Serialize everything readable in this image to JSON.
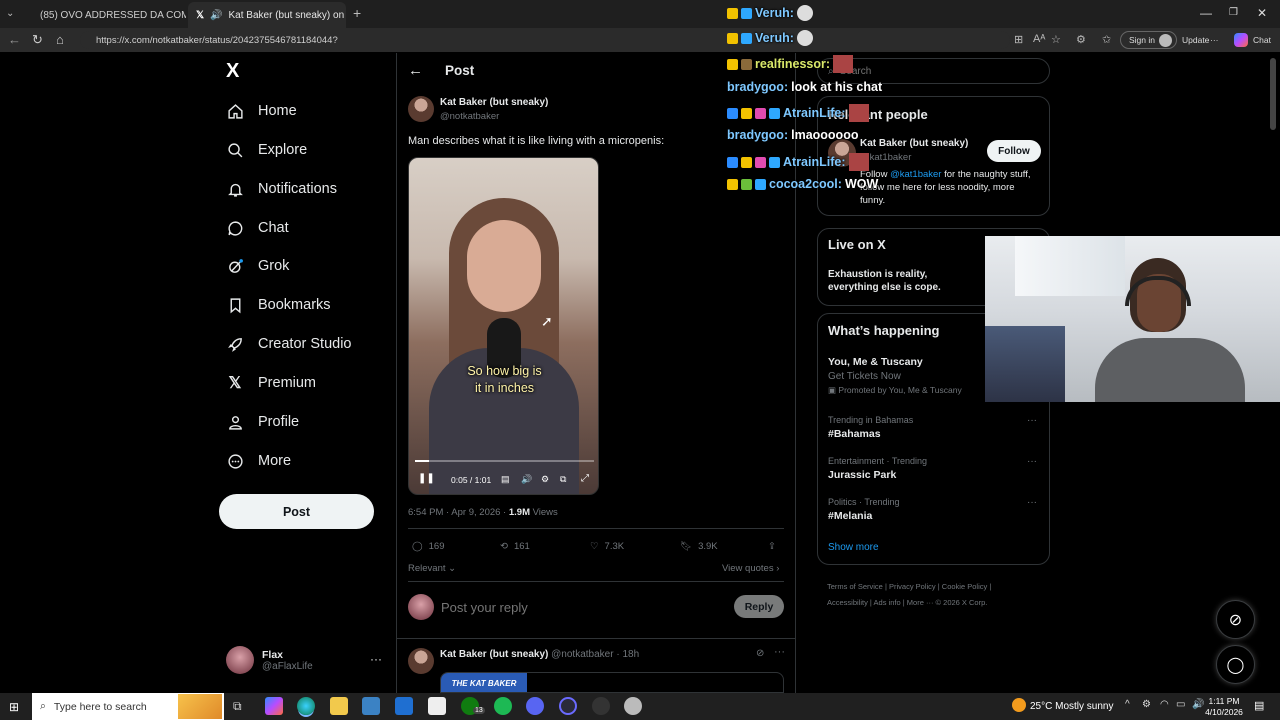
{
  "browser": {
    "tabs": [
      {
        "label": "(85) OVO ADDRESSED DA COMM..."
      },
      {
        "label": "Kat Baker (but sneaky) on X: \""
      }
    ],
    "url": "https://x.com/notkatbaker/status/2042375546781184044?",
    "signin_label": "Sign in",
    "update_label": "Update",
    "chat_label": "Chat"
  },
  "sidebar": {
    "logo": "X",
    "items": [
      {
        "label": "Home",
        "icon": "home-icon"
      },
      {
        "label": "Explore",
        "icon": "search-icon"
      },
      {
        "label": "Notifications",
        "icon": "bell-icon"
      },
      {
        "label": "Chat",
        "icon": "chat-icon"
      },
      {
        "label": "Grok",
        "icon": "grok-icon"
      },
      {
        "label": "Bookmarks",
        "icon": "bookmark-icon"
      },
      {
        "label": "Creator Studio",
        "icon": "rocket-icon"
      },
      {
        "label": "Premium",
        "icon": "x-premium-icon"
      },
      {
        "label": "Profile",
        "icon": "person-icon"
      },
      {
        "label": "More",
        "icon": "more-circle-icon"
      }
    ],
    "post_button": "Post",
    "account": {
      "name": "Flax",
      "handle": "@aFlaxLife"
    }
  },
  "post": {
    "header": "Post",
    "author": "Kat Baker (but sneaky)",
    "handle": "@notkatbaker",
    "text": "Man describes what it is like living with a micropenis:",
    "video_caption_1": "So how big is",
    "video_caption_2": "it in inches",
    "video_time": "0:05 / 1:01",
    "video_progress": 0.08,
    "timestamp": "6:54 PM · Apr 9, 2026 · ",
    "views_count": "1.9M",
    "views_label": " Views",
    "metrics": {
      "replies": "169",
      "reposts": "161",
      "likes": "7.3K",
      "bookmarks": "3.9K"
    },
    "relevant_label": "Relevant",
    "view_quotes": "View quotes",
    "reply_placeholder": "Post your reply",
    "reply_button": "Reply",
    "next_post": {
      "author": "Kat Baker (but sneaky)",
      "meta": "@notkatbaker · 18h",
      "thumb_text": "THE KAT BAKER"
    }
  },
  "right": {
    "search_placeholder": "Search",
    "relevant_people_title": "Relevant people",
    "person": {
      "name": "Kat Baker (but sneaky)",
      "handle": "@kat1baker",
      "follow": "Follow",
      "bio_prefix": "Follow ",
      "bio_link": "@kat1baker",
      "bio_suffix": " for the naughty stuff, follow me here for less noodity, more funny."
    },
    "live_title": "Live on X",
    "live_text": "Exhaustion is reality, everything else is cope.",
    "happening_title": "What’s happening",
    "promo": {
      "title": "You, Me & Tuscany",
      "sub": "Get Tickets Now",
      "promoted": "Promoted by You, Me & Tuscany"
    },
    "trends": [
      {
        "context": "Trending in Bahamas",
        "title": "#Bahamas"
      },
      {
        "context": "Entertainment · Trending",
        "title": "Jurassic Park"
      },
      {
        "context": "Politics · Trending",
        "title": "#Melania"
      }
    ],
    "show_more": "Show more",
    "footer": [
      "Terms of Service",
      "Privacy Policy",
      "Cookie Policy",
      "Accessibility",
      "Ads info",
      "More ···",
      "© 2026 X Corp."
    ]
  },
  "chat": [
    {
      "user": "Veruh:",
      "msg": "",
      "color": "#7ec8ff"
    },
    {
      "user": "Veruh:",
      "msg": "",
      "color": "#7ec8ff"
    },
    {
      "user": "realfinessor:",
      "msg": "",
      "color": "#d9e86a"
    },
    {
      "user": "bradygoo:",
      "msg": "look at his chat",
      "color": "#7ec8ff"
    },
    {
      "user": "AtrainLife:",
      "msg": "",
      "color": "#7ec8ff"
    },
    {
      "user": "bradygoo:",
      "msg": "lmaoooooo",
      "color": "#7ec8ff"
    },
    {
      "user": "AtrainLife:",
      "msg": "",
      "color": "#7ec8ff"
    },
    {
      "user": "cocoa2cool:",
      "msg": "WOW",
      "color": "#7ec8ff"
    }
  ],
  "taskbar": {
    "search_placeholder": "Type here to search",
    "weather": "25°C  Mostly sunny",
    "time": "1:11 PM",
    "date": "4/10/2026",
    "notif_count": "13"
  }
}
